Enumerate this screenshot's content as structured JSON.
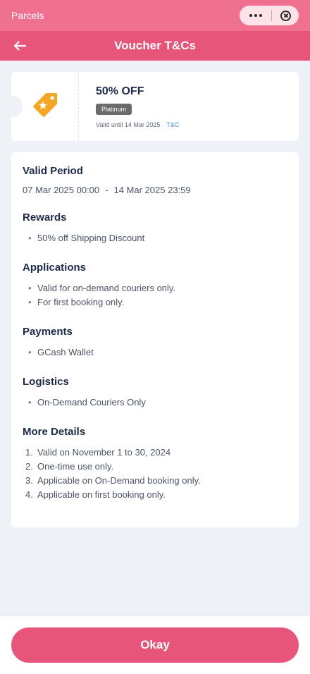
{
  "topbar": {
    "title": "Parcels"
  },
  "header": {
    "title": "Voucher T&Cs"
  },
  "voucher": {
    "title": "50% OFF",
    "badge": "Platinum",
    "valid_until": "Valid until 14 Mar 2025",
    "tnc_link": "T&C",
    "icon": "discount-tag-icon"
  },
  "sections": {
    "valid_period": {
      "heading": "Valid Period",
      "start": "07 Mar 2025 00:00",
      "separator": "-",
      "end": "14 Mar 2025 23:59"
    },
    "rewards": {
      "heading": "Rewards",
      "items": [
        "50% off Shipping Discount"
      ]
    },
    "applications": {
      "heading": "Applications",
      "items": [
        "Valid for on-demand couriers only.",
        "For first booking only."
      ]
    },
    "payments": {
      "heading": "Payments",
      "items": [
        "GCash Wallet"
      ]
    },
    "logistics": {
      "heading": "Logistics",
      "items": [
        "On-Demand Couriers Only"
      ]
    },
    "more_details": {
      "heading": "More Details",
      "items": [
        {
          "num": "1.",
          "text": "Valid on November 1 to 30, 2024"
        },
        {
          "num": "2.",
          "text": "One-time use only."
        },
        {
          "num": "3.",
          "text": "Applicable on On-Demand booking only."
        },
        {
          "num": "4.",
          "text": "Applicable on first booking only."
        }
      ]
    }
  },
  "bullet": "•",
  "footer": {
    "okay_label": "Okay"
  },
  "colors": {
    "brand": "#e8557a",
    "topbar": "#f0708f",
    "icon": "#f5a623",
    "link": "#4a90e2"
  }
}
